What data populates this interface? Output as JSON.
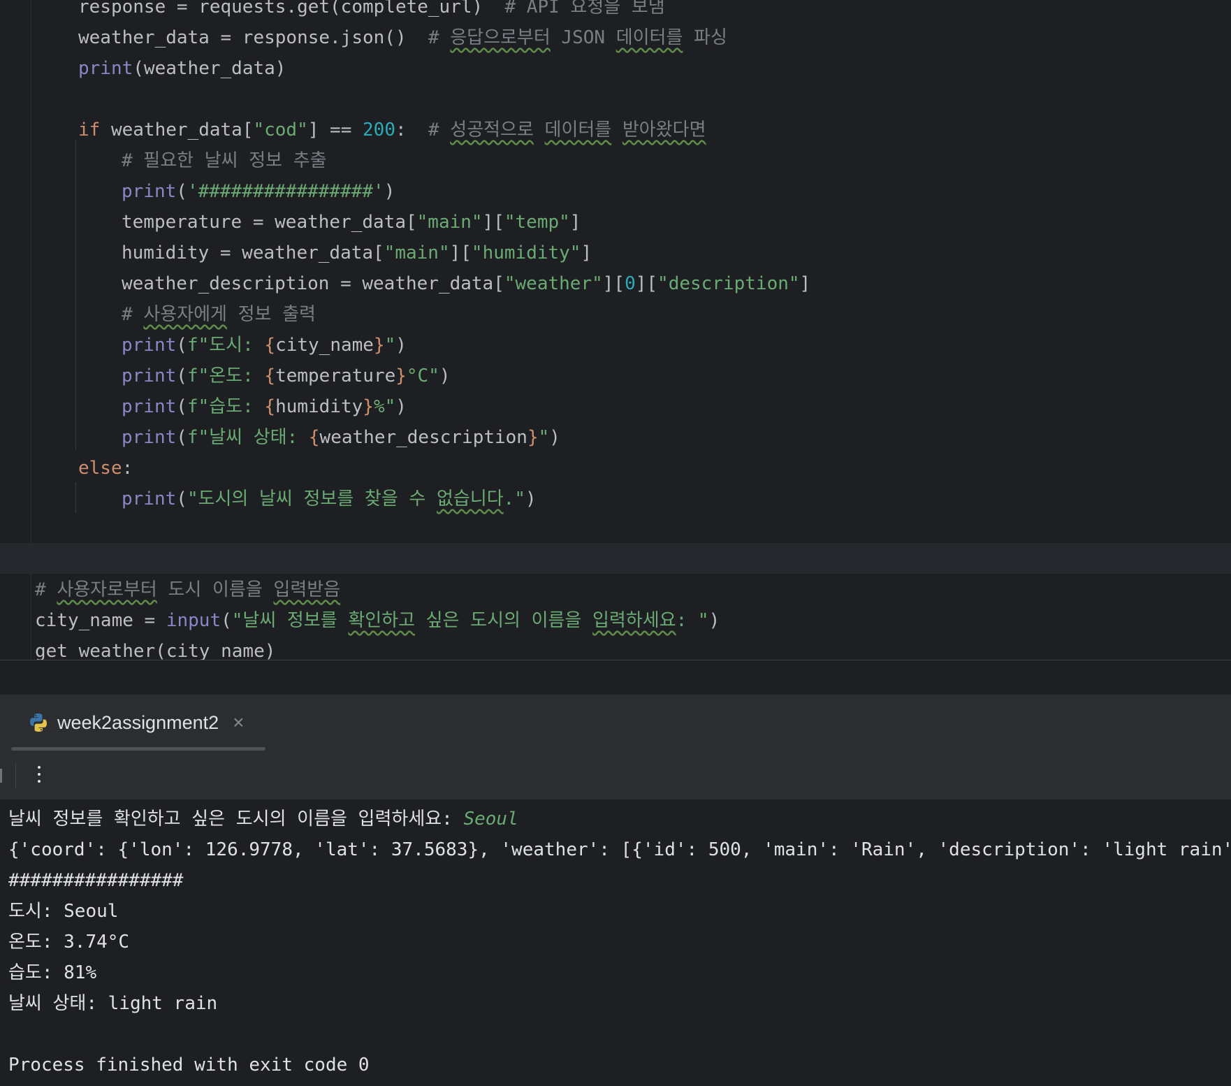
{
  "editor": {
    "lines": {
      "l1_code": "response = requests.get(complete_url)",
      "l1_comment": "# API 요청을 보냄",
      "l2_code": "weather_data = response.json()",
      "l2_comment_a": "# ",
      "l2_comment_b": "응답으로부터",
      "l2_comment_c": " JSON ",
      "l2_comment_d": "데이터를",
      "l2_comment_e": " 파싱",
      "l3_fn": "print",
      "l3_rest": "(weather_data)",
      "l5_kw": "if",
      "l5_a": " weather_data[",
      "l5_str": "\"cod\"",
      "l5_b": "] == ",
      "l5_num": "200",
      "l5_c": ":  ",
      "l5_cm_a": "# ",
      "l5_cm_b": "성공적으로",
      "l5_cm_c": " ",
      "l5_cm_d": "데이터를",
      "l5_cm_e": " ",
      "l5_cm_f": "받아왔다면",
      "l6_comment": "# 필요한 날씨 정보 추출",
      "l7_fn": "print",
      "l7_a": "(",
      "l7_str": "'################'",
      "l7_b": ")",
      "l8_a": "temperature = weather_data[",
      "l8_s1": "\"main\"",
      "l8_b": "][",
      "l8_s2": "\"temp\"",
      "l8_c": "]",
      "l9_a": "humidity = weather_data[",
      "l9_s1": "\"main\"",
      "l9_b": "][",
      "l9_s2": "\"humidity\"",
      "l9_c": "]",
      "l10_a": "weather_description = weather_data[",
      "l10_s1": "\"weather\"",
      "l10_b": "][",
      "l10_num": "0",
      "l10_c": "][",
      "l10_s2": "\"description\"",
      "l10_d": "]",
      "l11_a": "# ",
      "l11_b": "사용자에게",
      "l11_c": " 정보 출력",
      "l12_fn": "print",
      "l12_a": "(",
      "l12_s1": "f\"도시: ",
      "l12_br1": "{",
      "l12_var": "city_name",
      "l12_br2": "}",
      "l12_s2": "\"",
      "l12_b": ")",
      "l13_fn": "print",
      "l13_a": "(",
      "l13_s1": "f\"온도: ",
      "l13_br1": "{",
      "l13_var": "temperature",
      "l13_br2": "}",
      "l13_s2": "°C\"",
      "l13_b": ")",
      "l14_fn": "print",
      "l14_a": "(",
      "l14_s1": "f\"습도: ",
      "l14_br1": "{",
      "l14_var": "humidity",
      "l14_br2": "}",
      "l14_s2": "%\"",
      "l14_b": ")",
      "l15_fn": "print",
      "l15_a": "(",
      "l15_s1": "f\"날씨 상태: ",
      "l15_br1": "{",
      "l15_var": "weather_description",
      "l15_br2": "}",
      "l15_s2": "\"",
      "l15_b": ")",
      "l16_kw": "else",
      "l16_a": ":",
      "l17_fn": "print",
      "l17_a": "(",
      "l17_s1": "\"도시의 날씨 정보를 찾을 수 ",
      "l17_s2": "없습니다",
      "l17_s3": ".\"",
      "l17_b": ")",
      "l19_a": "# ",
      "l19_b": "사용자로부터",
      "l19_c": " 도시 이름을 ",
      "l19_d": "입력받음",
      "l20_a": "city_name = ",
      "l20_fn": "input",
      "l20_b": "(",
      "l20_s1": "\"날씨 정보를 ",
      "l20_s2": "확인하고",
      "l20_s3": " 싶은 도시의 이름을 ",
      "l20_s4": "입력하세요",
      "l20_s5": ": \"",
      "l20_c": ")",
      "l21": "get_weather(city_name)"
    }
  },
  "run_panel": {
    "tab_label": "week2assignment2",
    "tab_close": "×",
    "icon": "python-icon"
  },
  "console": {
    "prompt": "날씨 정보를 확인하고 싶은 도시의 이름을 입력하세요: ",
    "user_input": "Seoul",
    "json_output": "{'coord': {'lon': 126.9778, 'lat': 37.5683}, 'weather': [{'id': 500, 'main': 'Rain', 'description': 'light rain'",
    "hashes": "################",
    "city": "도시: Seoul",
    "temp": "온도: 3.74°C",
    "humidity": "습도: 81%",
    "status": "날씨 상태: light rain",
    "exit": "Process finished with exit code 0"
  },
  "colors": {
    "background": "#1e1f22",
    "panel": "#2b2d30",
    "keyword": "#cf8e6d",
    "string": "#6aab73",
    "builtin": "#8888c6",
    "number": "#2aacb8",
    "comment": "#7a7e85"
  }
}
